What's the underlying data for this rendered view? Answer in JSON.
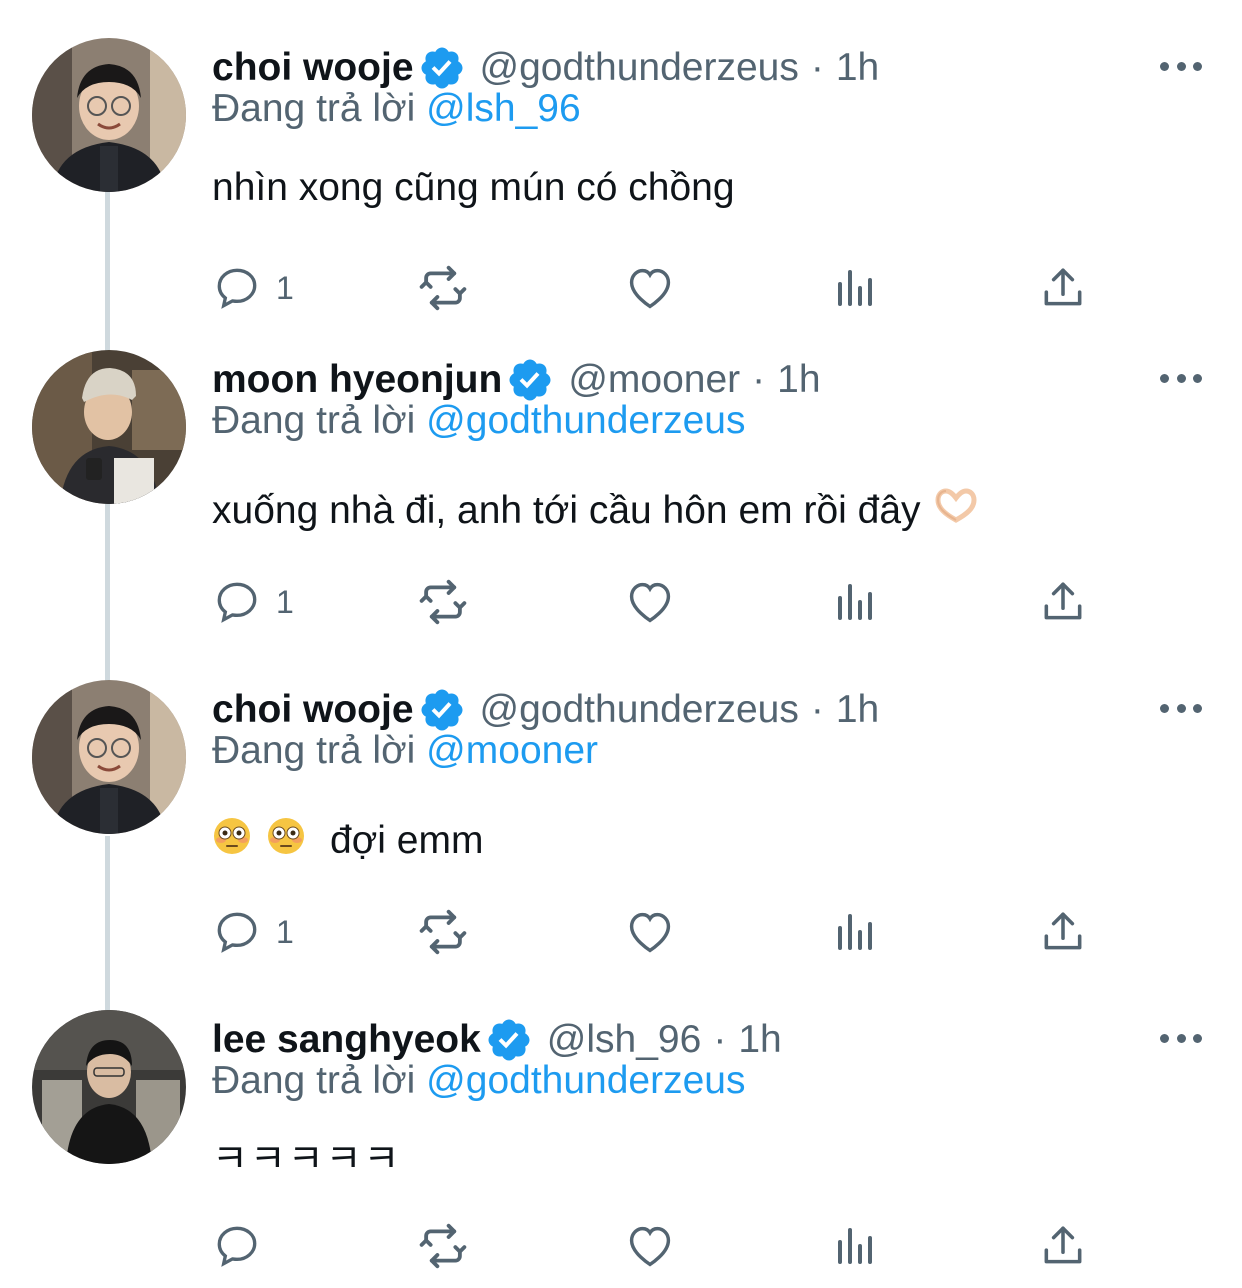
{
  "replying_prefix": "Đang trả lời",
  "tweets": [
    {
      "name": "choi wooje",
      "handle": "@godthunderzeus",
      "separator": "·",
      "time": "1h",
      "reply_to": "@lsh_96",
      "text": "nhìn xong cũng mún có chồng",
      "reply_count": "1"
    },
    {
      "name": "moon hyeonjun",
      "handle": "@mooner",
      "separator": "·",
      "time": "1h",
      "reply_to": "@godthunderzeus",
      "text": "xuống nhà đi, anh tới cầu hôn em rồi đây",
      "reply_count": "1"
    },
    {
      "name": "choi wooje",
      "handle": "@godthunderzeus",
      "separator": "·",
      "time": "1h",
      "reply_to": "@mooner",
      "text": "đợi emm",
      "reply_count": "1"
    },
    {
      "name": "lee sanghyeok",
      "handle": "@lsh_96",
      "separator": "·",
      "time": "1h",
      "reply_to": "@godthunderzeus",
      "text": "ㅋㅋㅋㅋㅋ",
      "reply_count": ""
    }
  ],
  "colors": {
    "text": "#0f1419",
    "secondary": "#536471",
    "link": "#1d9bf0",
    "verified": "#1d9bf0",
    "thread_line": "#cfd9de"
  },
  "icons": [
    "verified-badge-icon",
    "more-icon",
    "reply-icon",
    "retweet-icon",
    "like-icon",
    "views-icon",
    "share-icon",
    "heart-hands-emoji",
    "flushed-face-emoji"
  ]
}
